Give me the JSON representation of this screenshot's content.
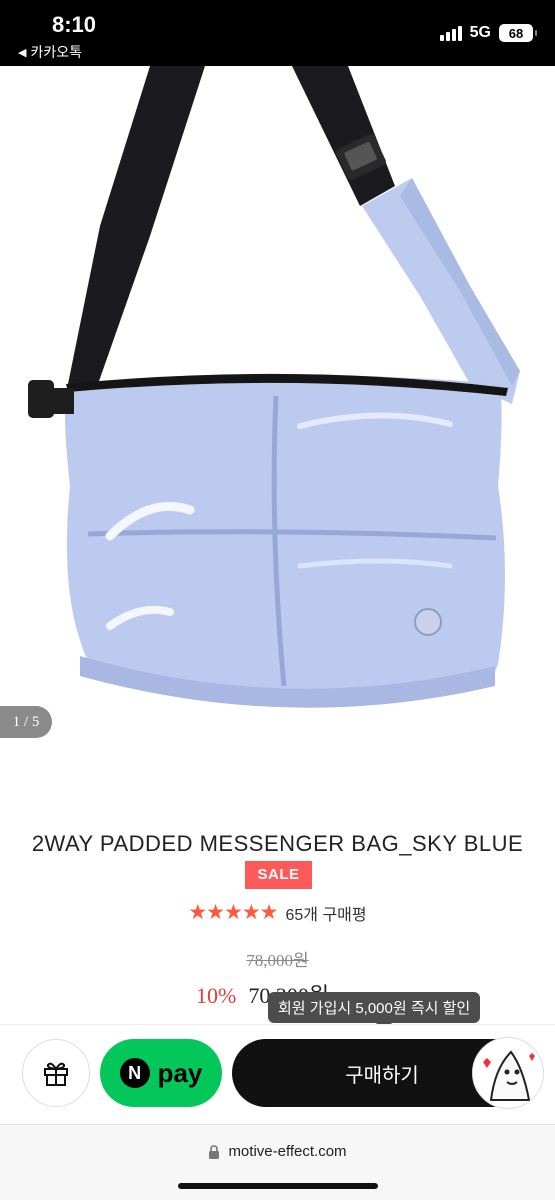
{
  "status_bar": {
    "time": "8:10",
    "back_label": "카카오톡",
    "network": "5G",
    "battery": "68"
  },
  "gallery": {
    "pager": "1 / 5"
  },
  "product": {
    "title": "2WAY PADDED MESSENGER BAG_SKY BLUE",
    "sale_badge": "SALE",
    "rating_stars": 5,
    "review_count": "65개 구매평",
    "original_price": "78,000원",
    "discount": "10%",
    "price": "70,200원"
  },
  "tooltip": {
    "text": "회원 가입시 5,000원 즉시 할인"
  },
  "actions": {
    "gift_icon": "gift-icon",
    "npay_n": "N",
    "npay_label": "pay",
    "buy_label": "구매하기"
  },
  "url_bar": {
    "url": "motive-effect.com"
  },
  "colors": {
    "accent_red": "#ff5a5a",
    "star": "#ff5a3c",
    "npay_green": "#03c75a",
    "bag_blue": "#b9c8ee"
  }
}
